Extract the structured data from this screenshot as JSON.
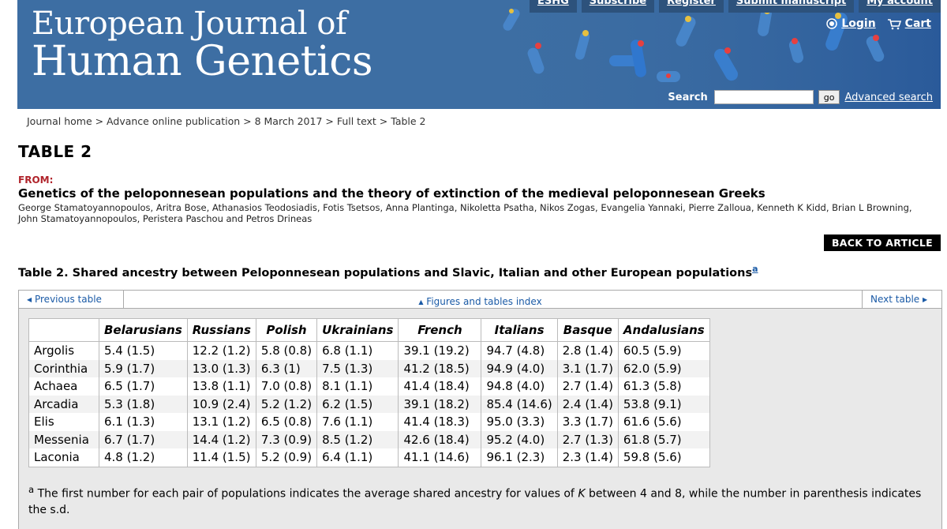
{
  "site": {
    "title_line1": "European Journal of",
    "title_line2": "Human Genetics",
    "top_nav": [
      "ESHG",
      "Subscribe",
      "Register",
      "Submit manuscript",
      "My account"
    ],
    "login_label": "Login",
    "cart_label": "Cart",
    "search_label": "Search",
    "search_value": "",
    "go_label": "go",
    "advanced_search_label": "Advanced search"
  },
  "breadcrumb": "Journal home > Advance online publication > 8 March 2017 > Full text > Table 2",
  "page_heading": "TABLE 2",
  "from_label": "FROM:",
  "article_title": "Genetics of the peloponnesean populations and the theory of extinction of the medieval peloponnesean Greeks",
  "authors": "George Stamatoyannopoulos, Aritra Bose, Athanasios Teodosiadis, Fotis Tsetsos, Anna Plantinga, Nikoletta Psatha, Nikos Zogas, Evangelia Yannaki, Pierre Zalloua, Kenneth K Kidd, Brian L Browning, John Stamatoyannopoulos, Peristera Paschou and Petros Drineas",
  "back_button": "BACK TO ARTICLE",
  "table_caption": "Table 2. Shared ancestry between Peloponnesean populations and Slavic, Italian and other European populations",
  "caption_note_mark": "a",
  "table_nav": {
    "previous": "Previous table",
    "index": "Figures and tables index",
    "next": "Next table"
  },
  "table": {
    "headers": [
      "",
      "Belarusians",
      "Russians",
      "Polish",
      "Ukrainians",
      "French",
      "Italians",
      "Basque",
      "Andalusians"
    ],
    "rows": [
      [
        "Argolis",
        "5.4 (1.5)",
        "12.2 (1.2)",
        "5.8 (0.8)",
        "6.8 (1.1)",
        "39.1 (19.2)",
        "94.7 (4.8)",
        "2.8 (1.4)",
        "60.5 (5.9)"
      ],
      [
        "Corinthia",
        "5.9 (1.7)",
        "13.0 (1.3)",
        "6.3 (1)",
        "7.5 (1.3)",
        "41.2 (18.5)",
        "94.9 (4.0)",
        "3.1 (1.7)",
        "62.0 (5.9)"
      ],
      [
        "Achaea",
        "6.5 (1.7)",
        "13.8 (1.1)",
        "7.0 (0.8)",
        "8.1 (1.1)",
        "41.4 (18.4)",
        "94.8 (4.0)",
        "2.7 (1.4)",
        "61.3 (5.8)"
      ],
      [
        "Arcadia",
        "5.3 (1.8)",
        "10.9 (2.4)",
        "5.2 (1.2)",
        "6.2 (1.5)",
        "39.1 (18.2)",
        "85.4 (14.6)",
        "2.4 (1.4)",
        "53.8 (9.1)"
      ],
      [
        "Elis",
        "6.1 (1.3)",
        "13.1 (1.2)",
        "6.5 (0.8)",
        "7.6 (1.1)",
        "41.4 (18.3)",
        "95.0 (3.3)",
        "3.3 (1.7)",
        "61.6 (5.6)"
      ],
      [
        "Messenia",
        "6.7 (1.7)",
        "14.4 (1.2)",
        "7.3 (0.9)",
        "8.5 (1.2)",
        "42.6 (18.4)",
        "95.2 (4.0)",
        "2.7 (1.3)",
        "61.8 (5.7)"
      ],
      [
        "Laconia",
        "4.8 (1.2)",
        "11.4 (1.5)",
        "5.2 (0.9)",
        "6.4 (1.1)",
        "41.1 (14.6)",
        "96.1 (2.3)",
        "2.3 (1.4)",
        "59.8 (5.6)"
      ]
    ]
  },
  "footnote": {
    "mark": "a",
    "text_before": " The first number for each pair of populations indicates the average shared ancestry for values of ",
    "italic": "K",
    "text_after": " between 4 and 8, while the number in parenthesis indicates the s.d."
  }
}
